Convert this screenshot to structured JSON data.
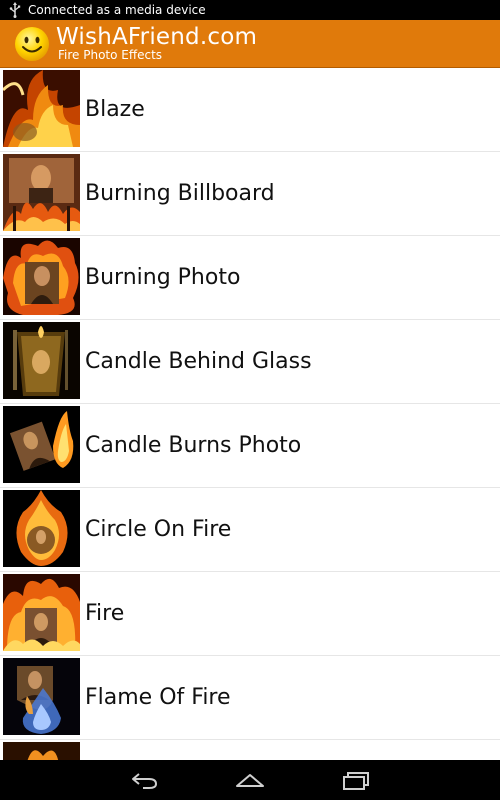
{
  "status_bar": {
    "text": "Connected as a media device",
    "icon": "usb-icon"
  },
  "header": {
    "logo_icon": "smiley-icon",
    "title": "WishAFriend.com",
    "subtitle": "Fire Photo Effects",
    "background": "#e07a0b"
  },
  "effects": [
    {
      "label": "Blaze",
      "thumbnail": "blaze-thumbnail"
    },
    {
      "label": "Burning Billboard",
      "thumbnail": "burning-billboard-thumbnail"
    },
    {
      "label": "Burning Photo",
      "thumbnail": "burning-photo-thumbnail"
    },
    {
      "label": "Candle Behind Glass",
      "thumbnail": "candle-behind-glass-thumbnail"
    },
    {
      "label": "Candle Burns Photo",
      "thumbnail": "candle-burns-photo-thumbnail"
    },
    {
      "label": "Circle On Fire",
      "thumbnail": "circle-on-fire-thumbnail"
    },
    {
      "label": "Fire",
      "thumbnail": "fire-thumbnail"
    },
    {
      "label": "Flame Of Fire",
      "thumbnail": "flame-of-fire-thumbnail"
    },
    {
      "label": "",
      "thumbnail": "partial-thumbnail"
    }
  ],
  "nav_bar": {
    "back_icon": "back-icon",
    "home_icon": "home-icon",
    "recents_icon": "recent-apps-icon"
  }
}
